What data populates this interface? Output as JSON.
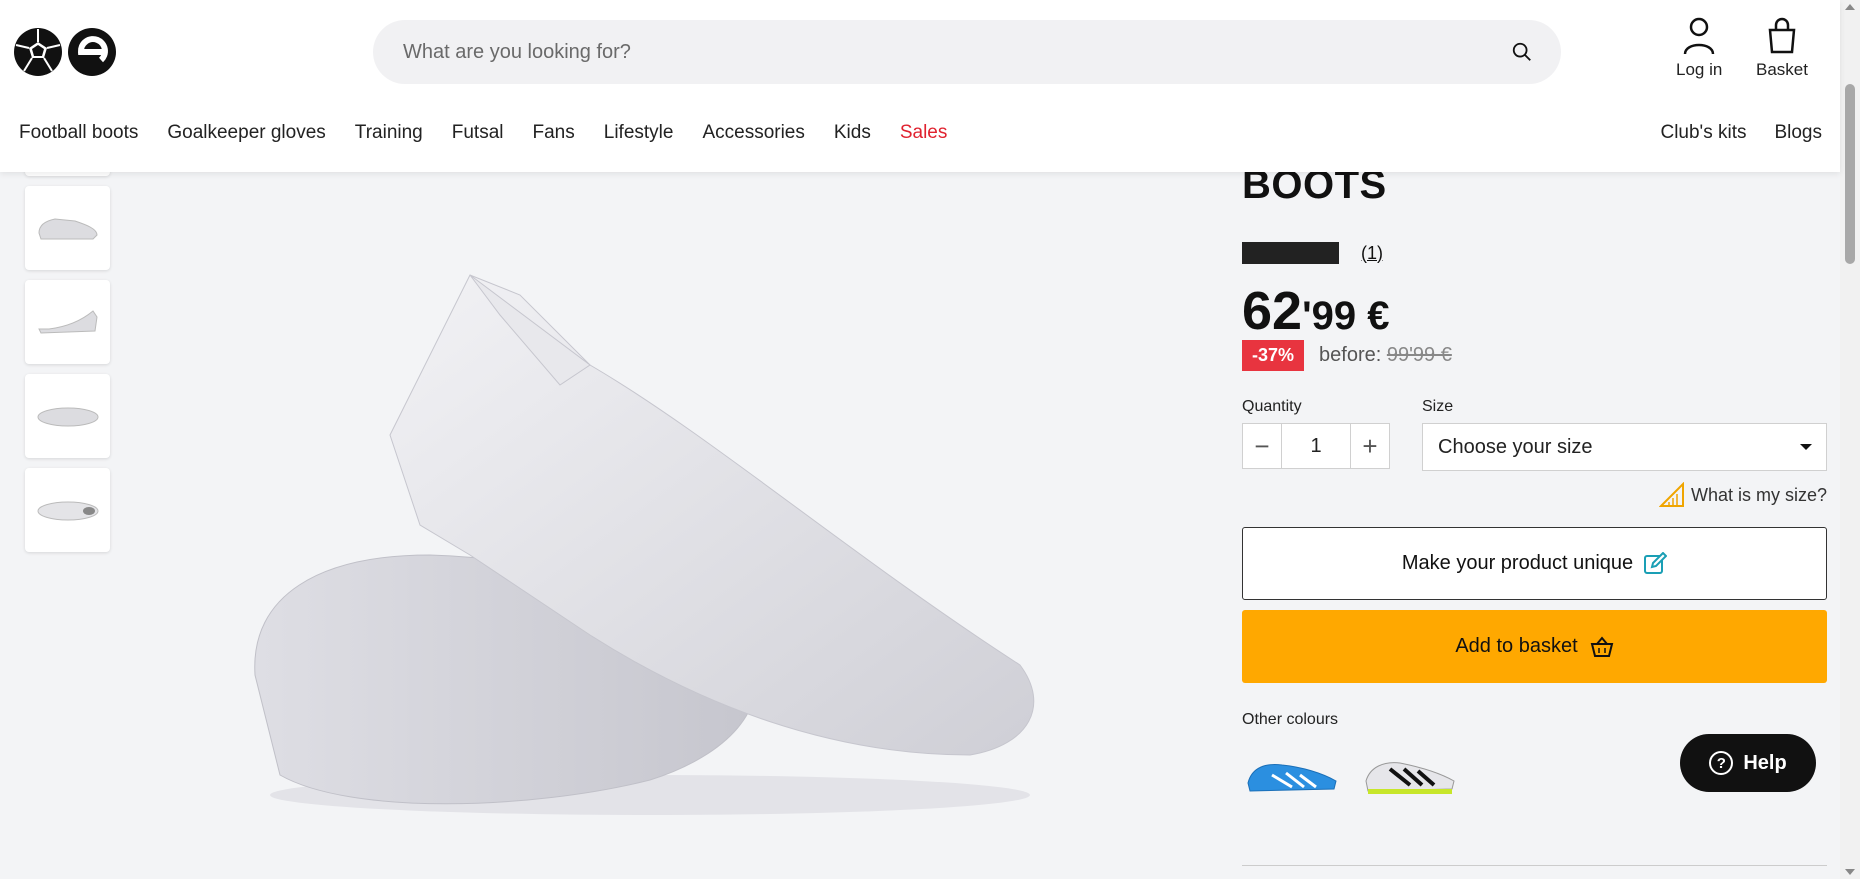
{
  "search": {
    "placeholder": "What are you looking for?"
  },
  "header": {
    "login_label": "Log in",
    "basket_label": "Basket"
  },
  "nav": {
    "items": [
      "Football boots",
      "Goalkeeper gloves",
      "Training",
      "Futsal",
      "Fans",
      "Lifestyle",
      "Accessories",
      "Kids",
      "Sales"
    ],
    "right": [
      "Club's kits",
      "Blogs"
    ]
  },
  "product": {
    "title_visible": "BOOTS",
    "review_count": "(1)",
    "price_int": "62",
    "price_dec": "'99 €",
    "discount": "-37%",
    "before_label": "before:",
    "old_price": "99'99 €",
    "quantity_label": "Quantity",
    "quantity_value": "1",
    "size_label": "Size",
    "size_placeholder": "Choose your size",
    "size_help": "What is my size?",
    "unique_label": "Make your product unique",
    "basket_label": "Add to basket",
    "colours_label": "Other colours"
  },
  "help": {
    "label": "Help"
  },
  "colors": {
    "accent": "#ffa800",
    "sale": "#e0222f",
    "badge": "#e8343f"
  }
}
